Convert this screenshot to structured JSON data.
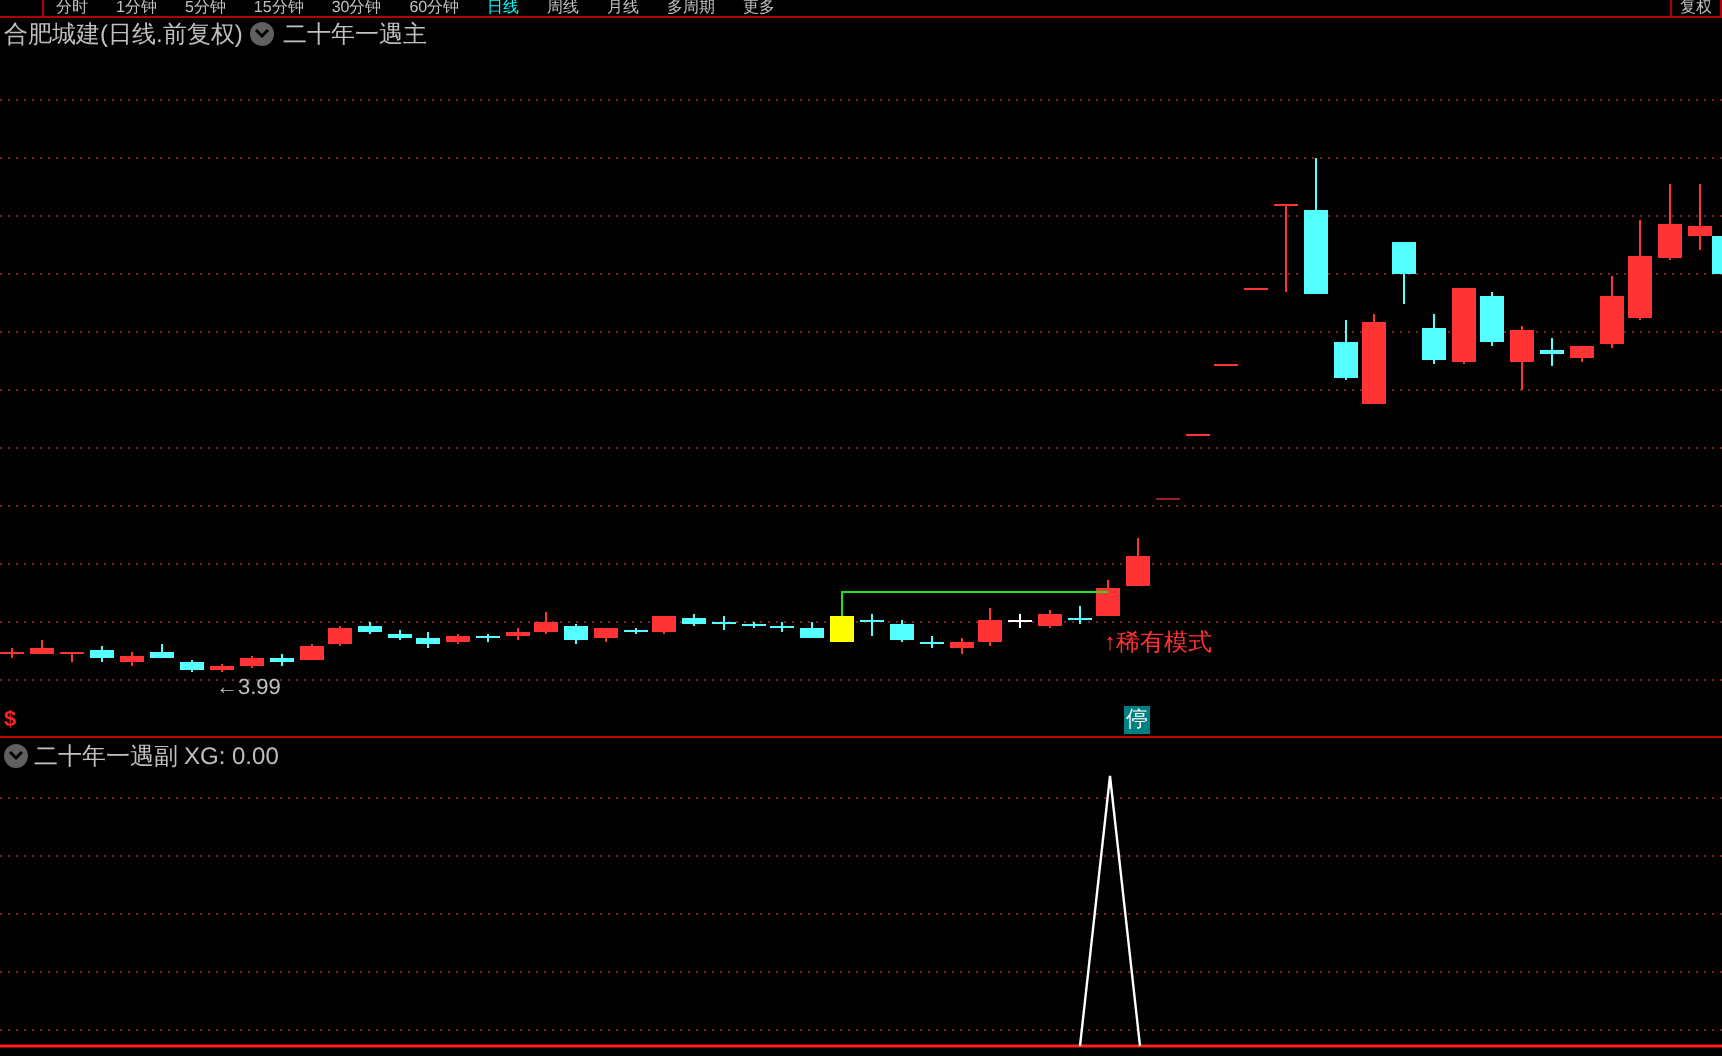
{
  "period_tabs": [
    {
      "label": "分时",
      "selected": false
    },
    {
      "label": "1分钟",
      "selected": false
    },
    {
      "label": "5分钟",
      "selected": false
    },
    {
      "label": "15分钟",
      "selected": false
    },
    {
      "label": "30分钟",
      "selected": false
    },
    {
      "label": "60分钟",
      "selected": false
    },
    {
      "label": "日线",
      "selected": true
    },
    {
      "label": "周线",
      "selected": false
    },
    {
      "label": "月线",
      "selected": false
    },
    {
      "label": "多周期",
      "selected": false
    },
    {
      "label": "更多",
      "selected": false
    }
  ],
  "top_right_button": "复权",
  "main_pane": {
    "title": "合肥城建(日线.前复权)",
    "indicator": "二十年一遇主",
    "low_label": "←3.99",
    "signal_label": "↑稀有模式",
    "halt_badge": "停",
    "marker": "$"
  },
  "sub_pane": {
    "indicator": "二十年一遇副",
    "reading": "XG: 0.00"
  }
}
